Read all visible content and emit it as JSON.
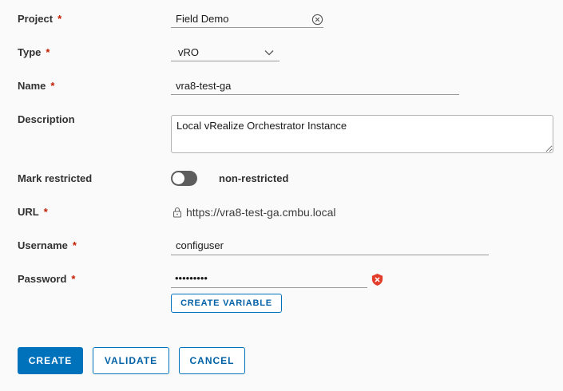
{
  "form": {
    "project": {
      "label": "Project",
      "required_mark": "*",
      "value": "Field Demo"
    },
    "type": {
      "label": "Type",
      "required_mark": "*",
      "value": "vRO"
    },
    "name": {
      "label": "Name",
      "required_mark": "*",
      "value": "vra8-test-ga"
    },
    "description": {
      "label": "Description",
      "value": "Local vRealize Orchestrator Instance"
    },
    "mark_restricted": {
      "label": "Mark restricted",
      "state_text": "non-restricted",
      "enabled": false
    },
    "url": {
      "label": "URL",
      "required_mark": "*",
      "value": "https://vra8-test-ga.cmbu.local"
    },
    "username": {
      "label": "Username",
      "required_mark": "*",
      "value": "configuser"
    },
    "password": {
      "label": "Password",
      "required_mark": "*",
      "value": "•••••••••",
      "create_variable_label": "CREATE VARIABLE"
    }
  },
  "actions": {
    "create_label": "CREATE",
    "validate_label": "VALIDATE",
    "cancel_label": "CANCEL"
  },
  "colors": {
    "accent": "#0072bc",
    "required": "#c21d00",
    "error_icon": "#e23d2a"
  },
  "icons": {
    "clear": "clear-circle-icon",
    "dropdown": "chevron-down-icon",
    "lock": "lock-icon",
    "error": "error-shield-icon",
    "resize": "resize-handle-icon"
  }
}
